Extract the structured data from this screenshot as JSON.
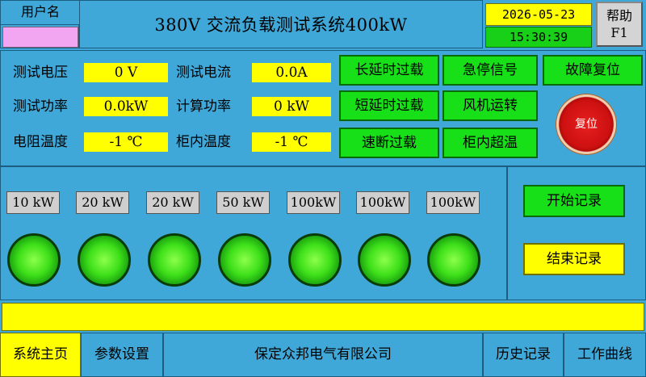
{
  "header": {
    "user_label": "用户名",
    "user_name": "",
    "title": "380V 交流负载测试系统400kW",
    "date": "2026-05-23",
    "time": "15:30:39",
    "help_line1": "帮助",
    "help_line2": "F1"
  },
  "measurements": {
    "test_voltage": {
      "label": "测试电压",
      "value": "0 V"
    },
    "test_current": {
      "label": "测试电流",
      "value": "0.0A"
    },
    "test_power": {
      "label": "测试功率",
      "value": "0.0kW"
    },
    "calc_power": {
      "label": "计算功率",
      "value": "0 kW"
    },
    "resistor_temp": {
      "label": "电阻温度",
      "value": "-1 ℃"
    },
    "cabinet_temp": {
      "label": "柜内温度",
      "value": "-1 ℃"
    }
  },
  "alarms": {
    "long_delay_overload": "长延时过载",
    "emergency_stop": "急停信号",
    "fault_reset": "故障复位",
    "short_delay_overload": "短延时过载",
    "fan_running": "风机运转",
    "instant_overload": "速断过载",
    "cabinet_overtemp": "柜内超温",
    "reset_button": "复位"
  },
  "loads": [
    {
      "label": "10 kW"
    },
    {
      "label": "20 kW"
    },
    {
      "label": "20 kW"
    },
    {
      "label": "50 kW"
    },
    {
      "label": "100kW"
    },
    {
      "label": "100kW"
    },
    {
      "label": "100kW"
    }
  ],
  "recording": {
    "start": "开始记录",
    "stop": "结束记录"
  },
  "message": "",
  "nav": {
    "home": "系统主页",
    "params": "参数设置",
    "company": "保定众邦电气有限公司",
    "history": "历史记录",
    "curve": "工作曲线"
  },
  "colors": {
    "background": "#3fa8d8",
    "value_yellow": "#ffff00",
    "status_green": "#18e018",
    "reset_red": "#cc1010",
    "lamp_green": "#3ee01a"
  }
}
